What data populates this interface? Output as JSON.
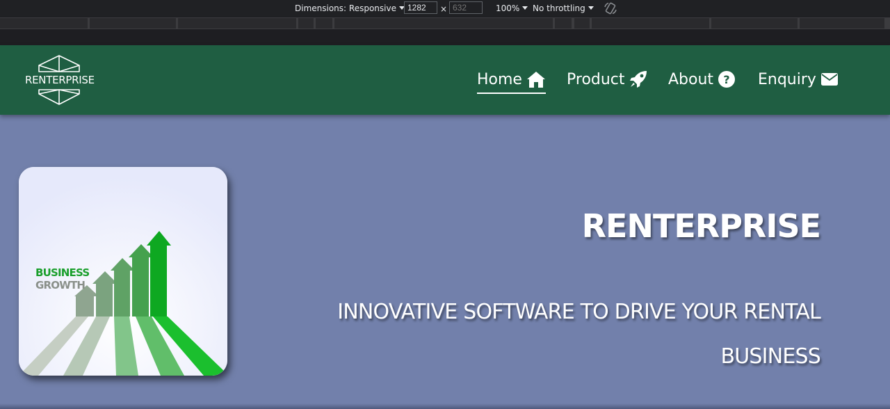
{
  "devtools": {
    "dimensions_label": "Dimensions: Responsive",
    "width_value": "1282",
    "times": "×",
    "height_value": "632",
    "zoom": "100%",
    "throttling": "No throttling"
  },
  "nav": {
    "logo_text": "RENTERPRISE",
    "links": [
      {
        "label": "Home",
        "icon": "home-icon"
      },
      {
        "label": "Product",
        "icon": "rocket-icon"
      },
      {
        "label": "About",
        "icon": "question-circle-icon"
      },
      {
        "label": "Enquiry",
        "icon": "envelope-icon"
      }
    ]
  },
  "hero": {
    "image_text_line1": "BUSINESS",
    "image_text_line2": "GROWTH",
    "title": "RENTERPRISE",
    "subtitle": "INNOVATIVE SOFTWARE TO DRIVE YOUR RENTAL BUSINESS"
  },
  "colors": {
    "nav_bg": "#1f5e42",
    "page_bg": "#7280ab",
    "devtools_bg": "#202124"
  }
}
